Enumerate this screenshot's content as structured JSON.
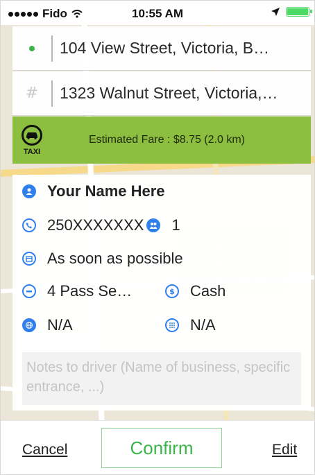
{
  "status_bar": {
    "carrier": "Fido",
    "time": "10:55 AM"
  },
  "pickup": {
    "address": "104 View Street, Victoria, B…"
  },
  "dropoff": {
    "address": "1323 Walnut Street, Victoria,…"
  },
  "fare": {
    "icon_label": "TAXI",
    "text": "Estimated Fare : $8.75 (2.0 km)"
  },
  "details": {
    "name": "Your Name Here",
    "phone": "250XXXXXXX",
    "passengers": "1",
    "time": "As soon as possible",
    "vehicle": "4 Pass Se…",
    "payment": "Cash",
    "field_a": "N/A",
    "field_b": "N/A",
    "notes_placeholder": "Notes to driver (Name of business, specific entrance, ...)"
  },
  "actions": {
    "cancel": "Cancel",
    "confirm": "Confirm",
    "edit": "Edit"
  },
  "colors": {
    "fare_bar": "#8cbe3f",
    "accent_blue": "#2f80ed",
    "confirm_green": "#39b54a"
  }
}
